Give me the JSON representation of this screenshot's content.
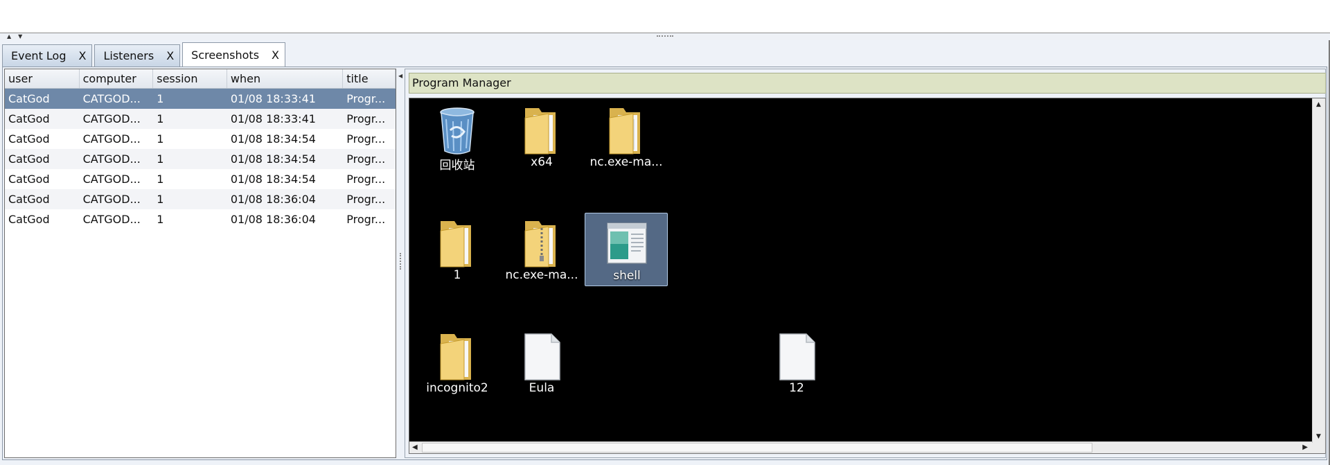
{
  "tabs": [
    {
      "label": "Event Log",
      "close": "X",
      "active": false
    },
    {
      "label": "Listeners",
      "close": "X",
      "active": false
    },
    {
      "label": "Screenshots",
      "close": "X",
      "active": true
    }
  ],
  "table": {
    "columns": [
      "user",
      "computer",
      "session",
      "when",
      "title"
    ],
    "rows": [
      {
        "user": "CatGod",
        "computer": "CATGOD...",
        "session": "1",
        "when": "01/08 18:33:41",
        "title": "Progr...",
        "selected": true
      },
      {
        "user": "CatGod",
        "computer": "CATGOD...",
        "session": "1",
        "when": "01/08 18:33:41",
        "title": "Progr...",
        "selected": false
      },
      {
        "user": "CatGod",
        "computer": "CATGOD...",
        "session": "1",
        "when": "01/08 18:34:54",
        "title": "Progr...",
        "selected": false
      },
      {
        "user": "CatGod",
        "computer": "CATGOD...",
        "session": "1",
        "when": "01/08 18:34:54",
        "title": "Progr...",
        "selected": false
      },
      {
        "user": "CatGod",
        "computer": "CATGOD...",
        "session": "1",
        "when": "01/08 18:34:54",
        "title": "Progr...",
        "selected": false
      },
      {
        "user": "CatGod",
        "computer": "CATGOD...",
        "session": "1",
        "when": "01/08 18:36:04",
        "title": "Progr...",
        "selected": false
      },
      {
        "user": "CatGod",
        "computer": "CATGOD...",
        "session": "1",
        "when": "01/08 18:36:04",
        "title": "Progr...",
        "selected": false
      }
    ]
  },
  "screenshot": {
    "title": "Program Manager",
    "desktop_icons": [
      {
        "label": "回收站",
        "icon": "recycle-bin-icon",
        "selected": false
      },
      {
        "label": "x64",
        "icon": "folder-icon",
        "selected": false
      },
      {
        "label": "nc.exe-ma...",
        "icon": "folder-icon",
        "selected": false
      },
      {
        "label": "1",
        "icon": "folder-icon",
        "selected": false
      },
      {
        "label": "nc.exe-ma...",
        "icon": "zip-folder-icon",
        "selected": false
      },
      {
        "label": "shell",
        "icon": "application-window-icon",
        "selected": true
      },
      {
        "label": "incognito2",
        "icon": "folder-icon",
        "selected": false
      },
      {
        "label": "Eula",
        "icon": "document-icon",
        "selected": false
      },
      {
        "label": "12",
        "icon": "document-icon",
        "selected": false
      }
    ]
  },
  "colors": {
    "selected_row": "#6e88a8",
    "title_bar": "#dde3c5",
    "desktop": "#000000",
    "icon_selection": "#87aad6"
  }
}
